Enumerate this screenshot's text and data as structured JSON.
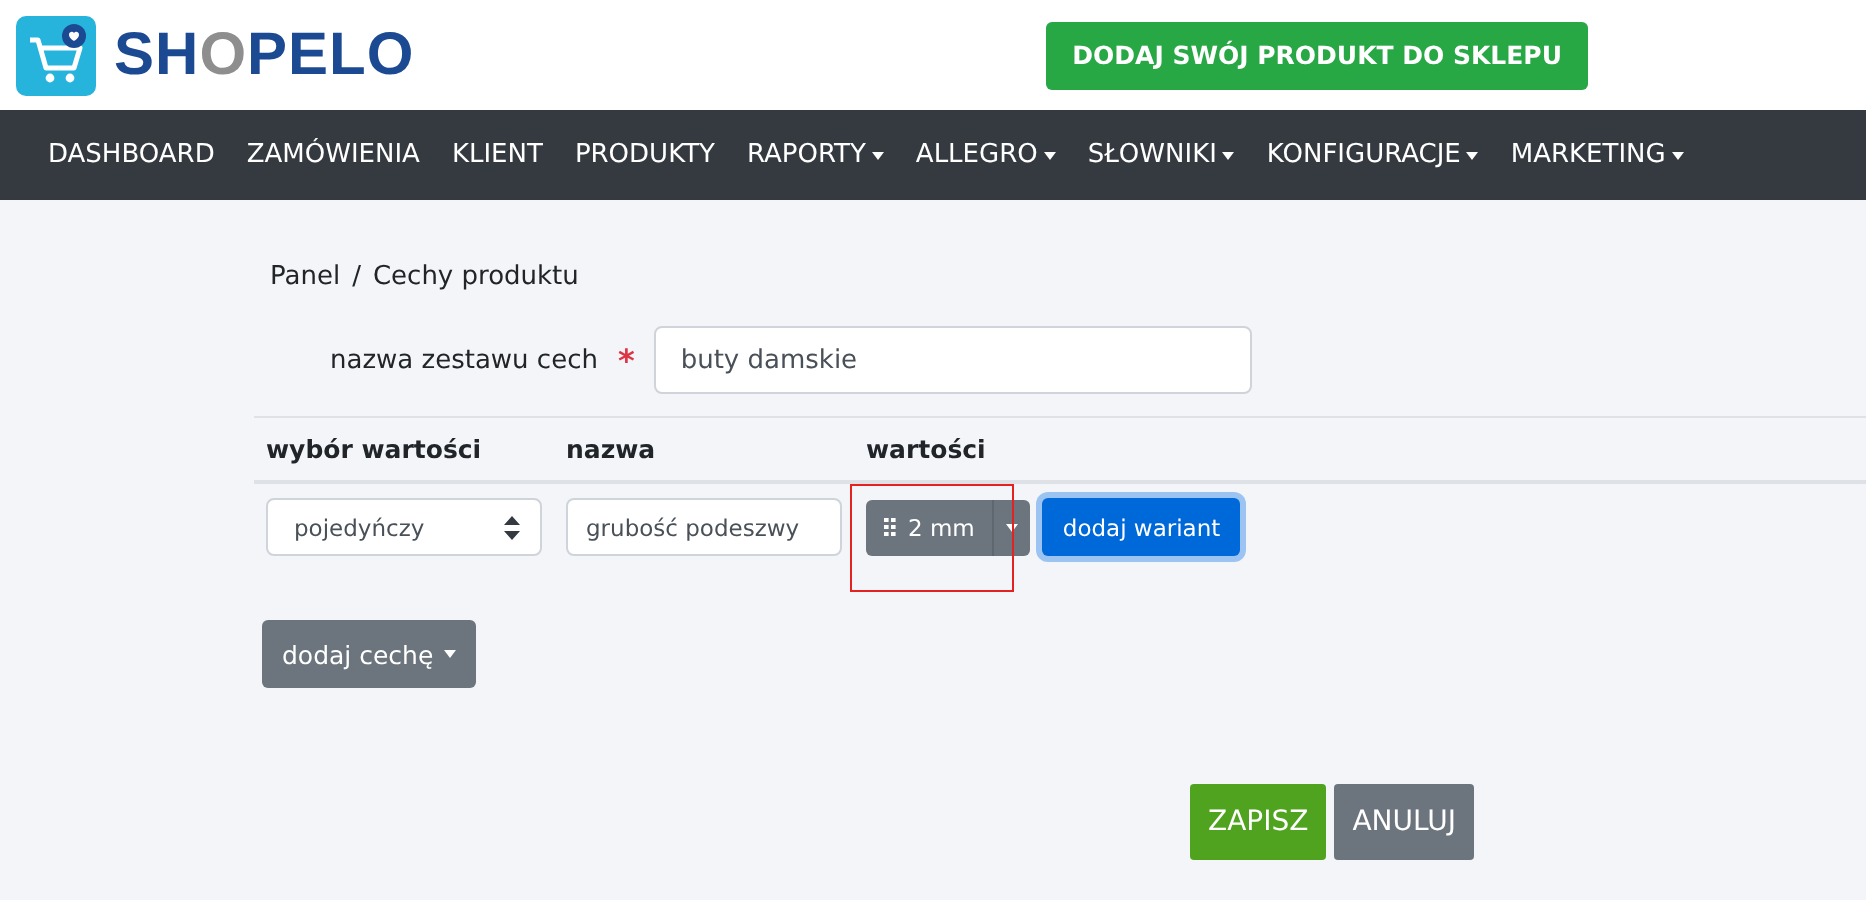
{
  "logo": {
    "parts": [
      {
        "text": "SH",
        "accent": false
      },
      {
        "text": "O",
        "accent": true
      },
      {
        "text": "PELO",
        "accent": false
      }
    ]
  },
  "header_button": "DODAJ SWÓJ PRODUKT DO SKLEPU",
  "nav": [
    {
      "label": "DASHBOARD",
      "dropdown": false
    },
    {
      "label": "ZAMÓWIENIA",
      "dropdown": false
    },
    {
      "label": "KLIENT",
      "dropdown": false
    },
    {
      "label": "PRODUKTY",
      "dropdown": false
    },
    {
      "label": "RAPORTY",
      "dropdown": true
    },
    {
      "label": "ALLEGRO",
      "dropdown": true
    },
    {
      "label": "SŁOWNIKI",
      "dropdown": true
    },
    {
      "label": "KONFIGURACJE",
      "dropdown": true
    },
    {
      "label": "MARKETING",
      "dropdown": true
    }
  ],
  "breadcrumb": {
    "items": [
      "Panel",
      "Cechy produktu"
    ],
    "separator": "/"
  },
  "set_name": {
    "label": "nazwa zestawu cech",
    "required": true,
    "required_mark": "*",
    "value": "buty damskie"
  },
  "table": {
    "columns": [
      "wybór wartości",
      "nazwa",
      "wartości"
    ],
    "rows": [
      {
        "selection": "pojedyńczy",
        "name": "grubość podeszwy",
        "values": [
          {
            "label": "2 mm",
            "highlighted": true
          }
        ],
        "add_variant": "dodaj wariant"
      }
    ]
  },
  "add_feature": "dodaj cechę",
  "buttons": {
    "save": "ZAPISZ",
    "cancel": "ANULUJ"
  }
}
